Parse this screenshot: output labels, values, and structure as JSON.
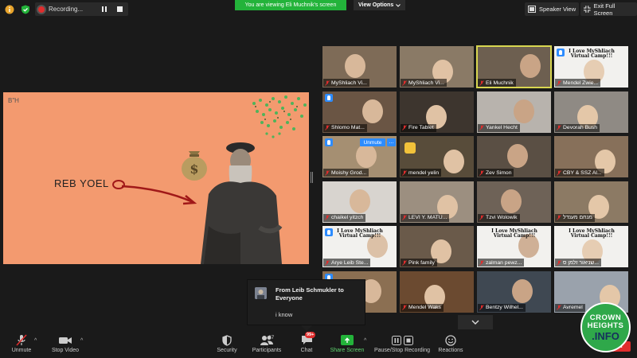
{
  "top": {
    "recording_label": "Recording...",
    "viewing_banner": "You are viewing Eli Muchnik's screen",
    "view_options": "View Options",
    "speaker_view": "Speaker View",
    "exit_full_screen": "Exit Full Screen"
  },
  "slide": {
    "corner_text": "B\"H",
    "name_text": "REB YOEL",
    "background": "#f39a6f"
  },
  "participants": [
    {
      "name": "MyShliach Vi..."
    },
    {
      "name": "MyShliach Vi..."
    },
    {
      "name": "Eli Muchnik",
      "active": true
    },
    {
      "name": "Mendel Zwie...",
      "sign": "I Love MyShliach Virtual Camp!!!"
    },
    {
      "name": "Shlomo Mat..."
    },
    {
      "name": "Fire Tablet"
    },
    {
      "name": "Yankel Hecht"
    },
    {
      "name": "Devorah Bush"
    },
    {
      "name": "Moishy Grod..."
    },
    {
      "name": "mendel yelin"
    },
    {
      "name": "Zev Simon"
    },
    {
      "name": "CBY & SSZ Al..."
    },
    {
      "name": "chaikel yitzch"
    },
    {
      "name": "LEVI Y. MATU..."
    },
    {
      "name": "Tzvi Wolowik"
    },
    {
      "name": "מנחם מענדל"
    },
    {
      "name": "Arye Leib Ste...",
      "sign": "I Love MyShliach Virtual Camp!!!"
    },
    {
      "name": "Pink family"
    },
    {
      "name": "zalman pewz...",
      "sign": "I Love MyShliach Virtual Camp!!!"
    },
    {
      "name": "שניאור זלמן ס...",
      "sign": "I Love MyShliach Virtual Camp!!!"
    },
    {
      "name": "..."
    },
    {
      "name": "Mendel Waks"
    },
    {
      "name": "Bentzy Wilhel..."
    },
    {
      "name": "Avremel"
    }
  ],
  "tile_overlay": {
    "unmute": "Unmute",
    "more": "…"
  },
  "chat": {
    "from": "From Leib Schmukler to Everyone",
    "message": "i know"
  },
  "toolbar": {
    "unmute": "Unmute",
    "stop_video": "Stop Video",
    "security": "Security",
    "participants": "Participants",
    "participants_count": "87",
    "chat": "Chat",
    "chat_badge": "99+",
    "share_screen": "Share Screen",
    "record": "Pause/Stop Recording",
    "reactions": "Reactions",
    "end": "End"
  },
  "watermark": {
    "line1": "CROWN",
    "line2": "HEIGHTS",
    "line3": ".INFO"
  },
  "colors": {
    "zoom_blue": "#2d8cff",
    "share_green": "#23b33a",
    "record_red": "#e02d2d",
    "active_speaker": "#d8d650"
  }
}
